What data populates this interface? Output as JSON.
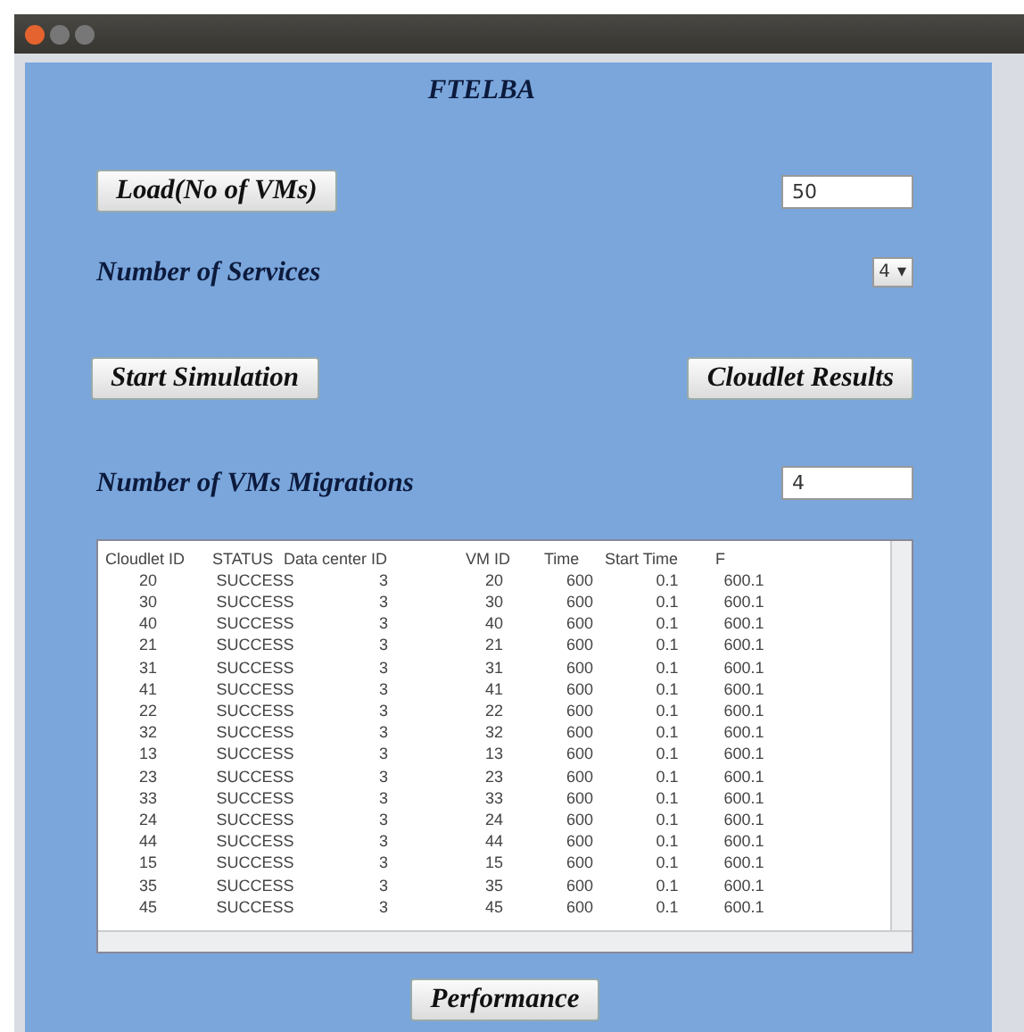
{
  "heading": "FTELBA",
  "load": {
    "button": "Load(No of VMs)",
    "value": "50"
  },
  "services": {
    "label": "Number of Services",
    "value": "4",
    "arrow": "▾"
  },
  "actions": [
    "Start Simulation",
    "Cloudlet Results"
  ],
  "migrations": {
    "label": "Number of VMs Migrations",
    "value": "4"
  },
  "table": {
    "columns": [
      "Cloudlet ID",
      "STATUS",
      "Data center ID",
      "VM ID",
      "Time",
      "Start Time",
      "F"
    ],
    "rows": [
      [
        "20",
        "SUCCESS",
        "3",
        "20",
        "600",
        "0.1",
        "600.1"
      ],
      [
        "30",
        "SUCCESS",
        "3",
        "30",
        "600",
        "0.1",
        "600.1"
      ],
      [
        "40",
        "SUCCESS",
        "3",
        "40",
        "600",
        "0.1",
        "600.1"
      ],
      [
        "21",
        "SUCCESS",
        "3",
        "21",
        "600",
        "0.1",
        "600.1"
      ],
      [
        "31",
        "SUCCESS",
        "3",
        "31",
        "600",
        "0.1",
        "600.1"
      ],
      [
        "41",
        "SUCCESS",
        "3",
        "41",
        "600",
        "0.1",
        "600.1"
      ],
      [
        "22",
        "SUCCESS",
        "3",
        "22",
        "600",
        "0.1",
        "600.1"
      ],
      [
        "32",
        "SUCCESS",
        "3",
        "32",
        "600",
        "0.1",
        "600.1"
      ],
      [
        "13",
        "SUCCESS",
        "3",
        "13",
        "600",
        "0.1",
        "600.1"
      ],
      [
        "23",
        "SUCCESS",
        "3",
        "23",
        "600",
        "0.1",
        "600.1"
      ],
      [
        "33",
        "SUCCESS",
        "3",
        "33",
        "600",
        "0.1",
        "600.1"
      ],
      [
        "24",
        "SUCCESS",
        "3",
        "24",
        "600",
        "0.1",
        "600.1"
      ],
      [
        "44",
        "SUCCESS",
        "3",
        "44",
        "600",
        "0.1",
        "600.1"
      ],
      [
        "15",
        "SUCCESS",
        "3",
        "15",
        "600",
        "0.1",
        "600.1"
      ],
      [
        "35",
        "SUCCESS",
        "3",
        "35",
        "600",
        "0.1",
        "600.1"
      ],
      [
        "45",
        "SUCCESS",
        "3",
        "45",
        "600",
        "0.1",
        "600.1"
      ]
    ]
  },
  "performance_button": "Performance"
}
